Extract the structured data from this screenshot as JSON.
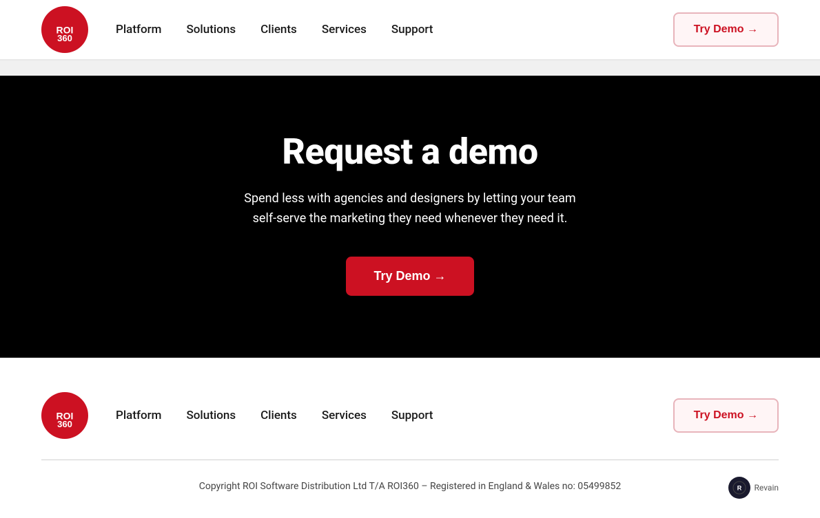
{
  "brand": {
    "name": "ROI360",
    "logo_text": "ROI360"
  },
  "header": {
    "nav": [
      {
        "label": "Platform",
        "id": "platform"
      },
      {
        "label": "Solutions",
        "id": "solutions"
      },
      {
        "label": "Clients",
        "id": "clients"
      },
      {
        "label": "Services",
        "id": "services"
      },
      {
        "label": "Support",
        "id": "support"
      }
    ],
    "cta_label": "Try Demo →"
  },
  "hero": {
    "title": "Request a demo",
    "subtitle": "Spend less with agencies and designers by letting your team self-serve the marketing they need whenever they need it.",
    "cta_label": "Try Demo →"
  },
  "footer": {
    "nav": [
      {
        "label": "Platform",
        "id": "platform"
      },
      {
        "label": "Solutions",
        "id": "solutions"
      },
      {
        "label": "Clients",
        "id": "clients"
      },
      {
        "label": "Services",
        "id": "services"
      },
      {
        "label": "Support",
        "id": "support"
      }
    ],
    "cta_label": "Try Demo →",
    "copyright": "Copyright ROI Software Distribution Ltd T/A ROI360 – Registered in England & Wales no: 05499852",
    "revain_label": "Revain"
  }
}
